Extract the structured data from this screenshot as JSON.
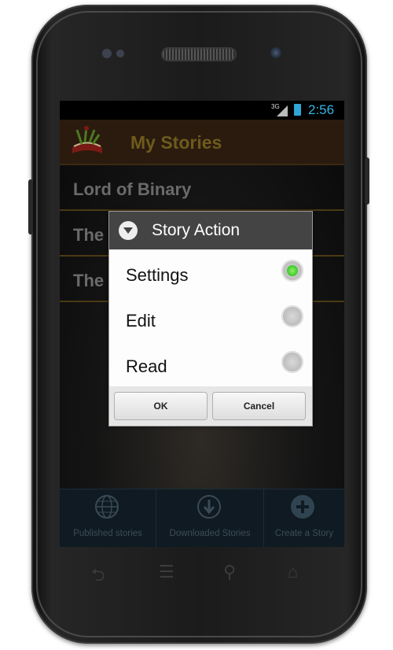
{
  "status_bar": {
    "network": "3G",
    "time": "2:56"
  },
  "app": {
    "title": "My Stories"
  },
  "stories": [
    {
      "label": "Lord of Binary"
    },
    {
      "label": "The"
    },
    {
      "label": "The"
    }
  ],
  "bottom_bar": {
    "tabs": [
      {
        "label": "Published stories",
        "icon": "globe-icon"
      },
      {
        "label": "Downloaded Stories",
        "icon": "download-icon"
      },
      {
        "label": "Create a Story",
        "icon": "plus-icon"
      }
    ]
  },
  "dialog": {
    "title": "Story Action",
    "options": [
      {
        "label": "Settings",
        "selected": true
      },
      {
        "label": "Edit",
        "selected": false
      },
      {
        "label": "Read",
        "selected": false
      }
    ],
    "ok_label": "OK",
    "cancel_label": "Cancel"
  },
  "colors": {
    "accent_time": "#33b5e5",
    "title_gold": "#6e5a1c",
    "radio_selected": "#3cc82a"
  }
}
